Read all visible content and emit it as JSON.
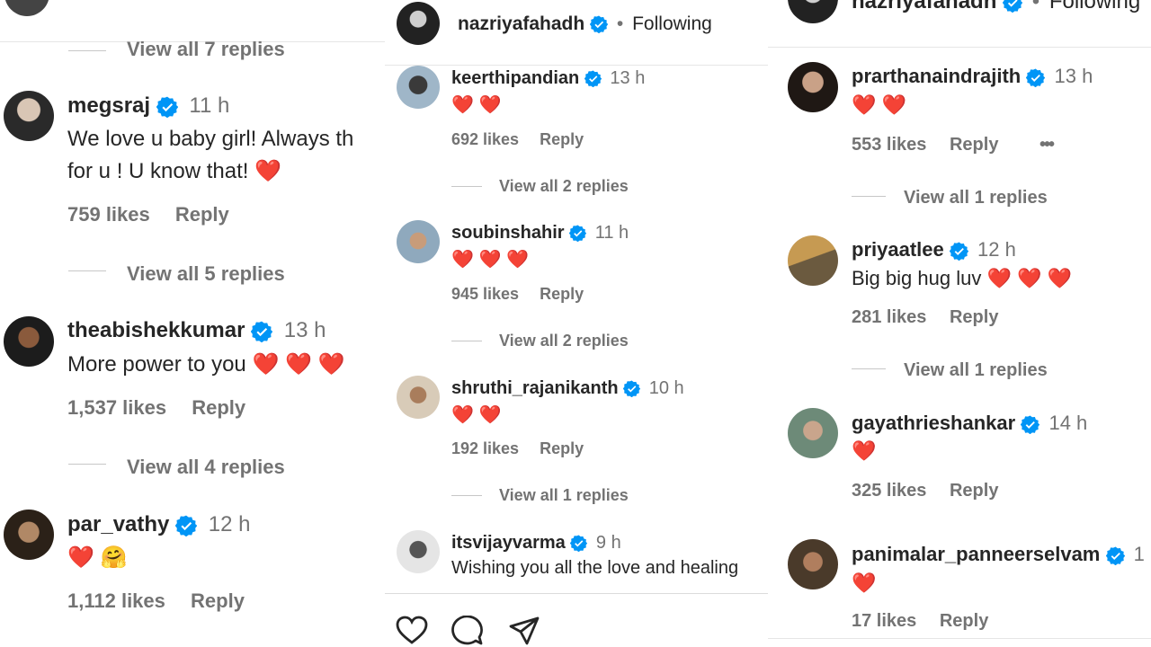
{
  "panel1": {
    "top_view_replies": "View all 7 replies",
    "comments": [
      {
        "user": "megsraj",
        "time": "11 h",
        "lines": [
          "We love u baby girl! Always th",
          "for u ! U know that! ❤️"
        ],
        "likes": "759 likes",
        "reply": "Reply",
        "view_replies": "View all 5 replies"
      },
      {
        "user": "theabishekkumar",
        "time": "13 h",
        "lines": [
          "More power to you ❤️ ❤️ ❤️"
        ],
        "likes": "1,537 likes",
        "reply": "Reply",
        "view_replies": "View all 4 replies"
      },
      {
        "user": "par_vathy",
        "time": "12 h",
        "lines": [
          "❤️ 🤗"
        ],
        "likes": "1,112 likes",
        "reply": "Reply"
      }
    ]
  },
  "panel2": {
    "header": {
      "user": "nazriyafahadh",
      "dot": "•",
      "following": "Following"
    },
    "comments": [
      {
        "user": "keerthipandian",
        "time": "13 h",
        "text": "❤️ ❤️",
        "likes": "692 likes",
        "reply": "Reply",
        "view_replies": "View all 2 replies"
      },
      {
        "user": "soubinshahir",
        "time": "11 h",
        "text": "❤️ ❤️ ❤️",
        "likes": "945 likes",
        "reply": "Reply",
        "view_replies": "View all 2 replies"
      },
      {
        "user": "shruthi_rajanikanth",
        "time": "10 h",
        "text": "❤️ ❤️",
        "likes": "192 likes",
        "reply": "Reply",
        "view_replies": "View all 1 replies"
      },
      {
        "user": "itsvijayvarma",
        "time": "9 h",
        "text": "Wishing you all the love and healing"
      }
    ],
    "actions": [
      "heart-icon",
      "comment-icon",
      "share-icon"
    ]
  },
  "panel3": {
    "header": {
      "user": "nazriyafahadh",
      "dot": "•",
      "following": "Following"
    },
    "comments": [
      {
        "user": "prarthanaindrajith",
        "time": "13 h",
        "text": "❤️ ❤️",
        "likes": "553 likes",
        "reply": "Reply",
        "more": "•••",
        "view_replies": "View all 1 replies"
      },
      {
        "user": "priyaatlee",
        "time": "12 h",
        "text": "Big big hug luv ❤️ ❤️ ❤️",
        "likes": "281 likes",
        "reply": "Reply",
        "view_replies": "View all 1 replies"
      },
      {
        "user": "gayathrieshankar",
        "time": "14 h",
        "text": "❤️",
        "likes": "325 likes",
        "reply": "Reply"
      },
      {
        "user": "panimalar_panneerselvam",
        "time": "1",
        "text": "❤️",
        "likes": "17 likes",
        "reply": "Reply"
      }
    ]
  },
  "colors": {
    "verified": "#0095f6",
    "heart": "#ed1c24",
    "muted": "#737373",
    "text": "#262626"
  }
}
